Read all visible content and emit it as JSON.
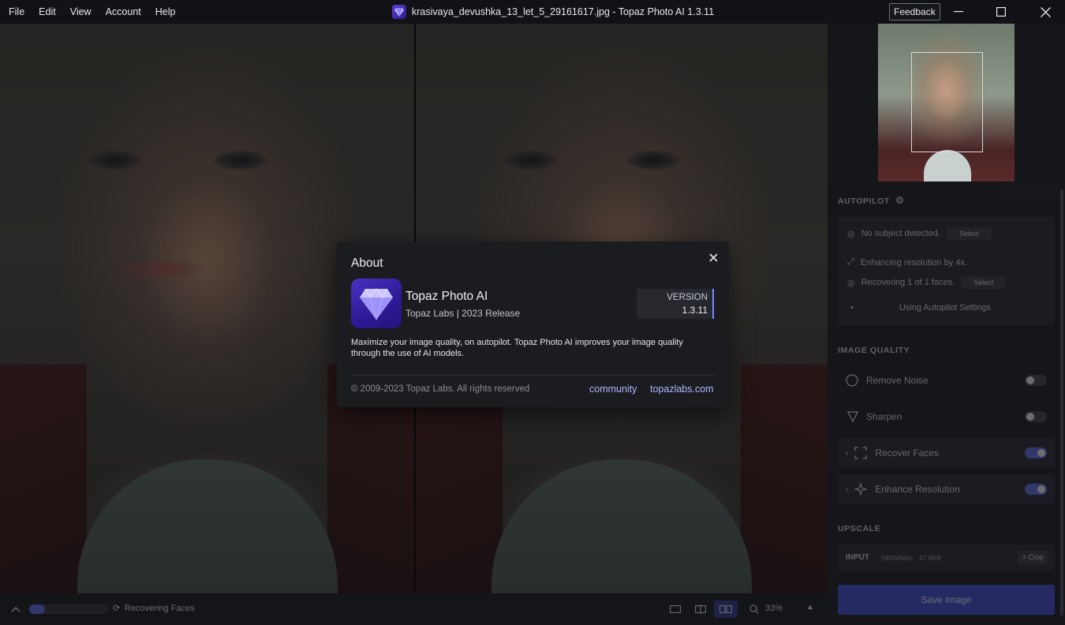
{
  "menu": [
    "File",
    "Edit",
    "View",
    "Account",
    "Help"
  ],
  "window": {
    "title": "krasivaya_devushka_13_let_5_29161617.jpg - Topaz Photo AI 1.3.11",
    "feedback_label": "Feedback"
  },
  "autopilot": {
    "title": "AUTOPILOT",
    "subject_text": "No subject detected.",
    "subject_button": "Select",
    "enhance_text": "Enhancing resolution by 4x.",
    "faces_text": "Recovering 1 of 1 faces.",
    "faces_button": "Select",
    "settings_text": "Using Autopilot Settings"
  },
  "image_quality": {
    "title": "IMAGE QUALITY",
    "items": [
      {
        "label": "Remove Noise",
        "enabled": false
      },
      {
        "label": "Sharpen",
        "enabled": false
      },
      {
        "label": "Recover Faces",
        "enabled": true
      },
      {
        "label": "Enhance Resolution",
        "enabled": true
      }
    ]
  },
  "upscale": {
    "title": "UPSCALE",
    "input_label": "INPUT",
    "input_detail": "ORIGINAL · 47.6KB",
    "crop_label": "Crop"
  },
  "save_label": "Save Image",
  "bottom": {
    "status": "Recovering Faces",
    "progress": 0.2,
    "zoom": "33%"
  },
  "about": {
    "title": "About",
    "app_name": "Topaz Photo AI",
    "app_sub": "Topaz Labs | 2023 Release",
    "version_label": "VERSION",
    "version_number": "1.3.11",
    "description": "Maximize your image quality, on autopilot. Topaz Photo AI improves your image quality through the use of AI models.",
    "copyright": "© 2009-2023 Topaz Labs. All rights reserved",
    "link_community": "community",
    "link_site": "topazlabs.com"
  },
  "colors": {
    "accent": "#5b66d9",
    "link": "#aeb8ff",
    "save_button": "#3b46c9"
  }
}
